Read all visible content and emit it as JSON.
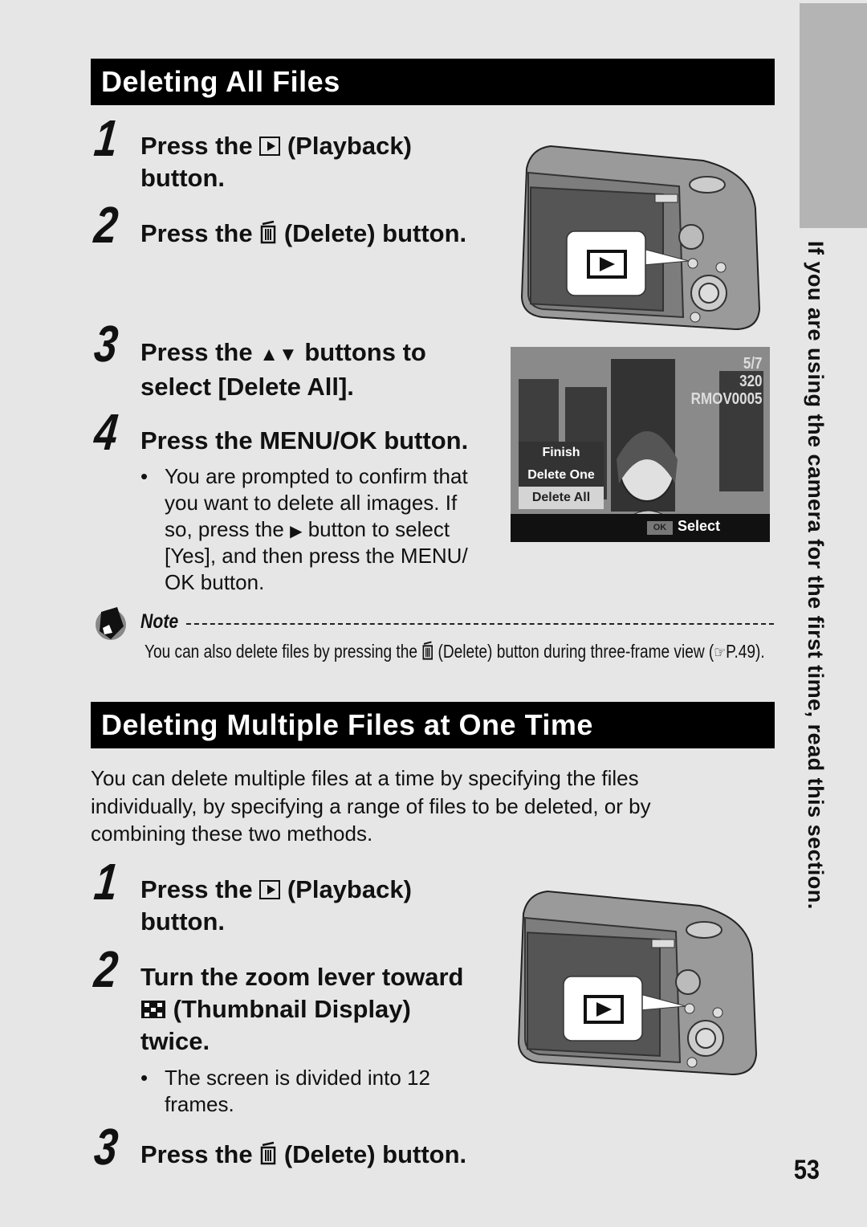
{
  "side_tab": {
    "text": "If you are using the camera for the first time, read this section."
  },
  "page_number": "53",
  "section1": {
    "title": "Deleting All Files",
    "steps": [
      {
        "num": "1",
        "pre": "Press the",
        "icon": "playback-icon",
        "post": "(Playback)",
        "line2": "button."
      },
      {
        "num": "2",
        "pre": "Press the",
        "icon": "delete-icon",
        "post": "(Delete) button."
      },
      {
        "num": "3",
        "pre": "Press the",
        "icon": "up-down-icon",
        "glyph": "▲▼",
        "post": "buttons to",
        "line2": "select [Delete All]."
      },
      {
        "num": "4",
        "text": "Press the MENU/OK button."
      }
    ],
    "bullet": {
      "lines": [
        "You are prompted to confirm that",
        "you want to delete all images. If",
        "so, press the",
        "button to select",
        "[Yes], and then press the MENU/",
        "OK button."
      ],
      "right_glyph": "▶"
    },
    "lcd": {
      "counter": "5/7",
      "size": "320",
      "file": "RMOV0005",
      "menu": [
        "Finish",
        "Delete One",
        "Delete All"
      ],
      "selected": "Delete All",
      "ok_label": "OK",
      "select_label": "Select"
    }
  },
  "note": {
    "label": "Note",
    "text_pre": "You can also delete files by pressing the",
    "text_post": "(Delete) button during three-frame view (",
    "ref": "P.49)."
  },
  "section2": {
    "title": "Deleting Multiple Files at One Time",
    "intro": "You can delete multiple files at a time by specifying the files individually, by specifying a range of files to be deleted, or by combining these two methods.",
    "steps": [
      {
        "num": "1",
        "pre": "Press the",
        "post": "(Playback)",
        "line2": "button."
      },
      {
        "num": "2",
        "line1": "Turn the zoom lever toward",
        "post": "(Thumbnail Display)",
        "line3": "twice."
      },
      {
        "num": "3",
        "pre": "Press the",
        "post": "(Delete) button."
      }
    ],
    "bullet": {
      "lines": [
        "The screen is divided into 12",
        "frames."
      ]
    }
  },
  "callout": {
    "glyph": "playback"
  }
}
